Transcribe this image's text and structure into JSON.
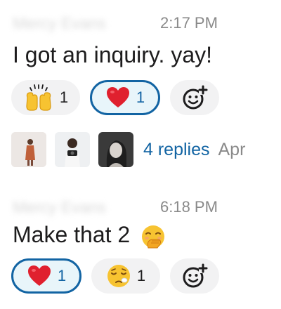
{
  "messages": [
    {
      "sender_name_blurred": "Mercy Evans",
      "time": "2:17 PM",
      "text": "I got an inquiry. yay!",
      "reactions": [
        {
          "emoji": "raising-hands",
          "count": "1",
          "active": false
        },
        {
          "emoji": "red-heart",
          "count": "1",
          "active": true
        },
        {
          "emoji": "add-reaction",
          "count": null,
          "active": false
        }
      ],
      "thread": {
        "replies_label": "4 replies",
        "last_reply": "Apr"
      }
    },
    {
      "sender_name_blurred": "Mercy Evans",
      "time": "6:18 PM",
      "text": "Make that 2",
      "inline_emoji": "face-with-hand-over-mouth",
      "reactions": [
        {
          "emoji": "red-heart",
          "count": "1",
          "active": true
        },
        {
          "emoji": "sleepy-face",
          "count": "1",
          "active": false
        },
        {
          "emoji": "add-reaction",
          "count": null,
          "active": false
        }
      ]
    }
  ],
  "colors": {
    "accent": "#1264a3",
    "active_bg": "#e8f5fa",
    "pill_bg": "#f2f2f3",
    "text": "#1d1c1d",
    "muted": "#8a8a8a"
  }
}
